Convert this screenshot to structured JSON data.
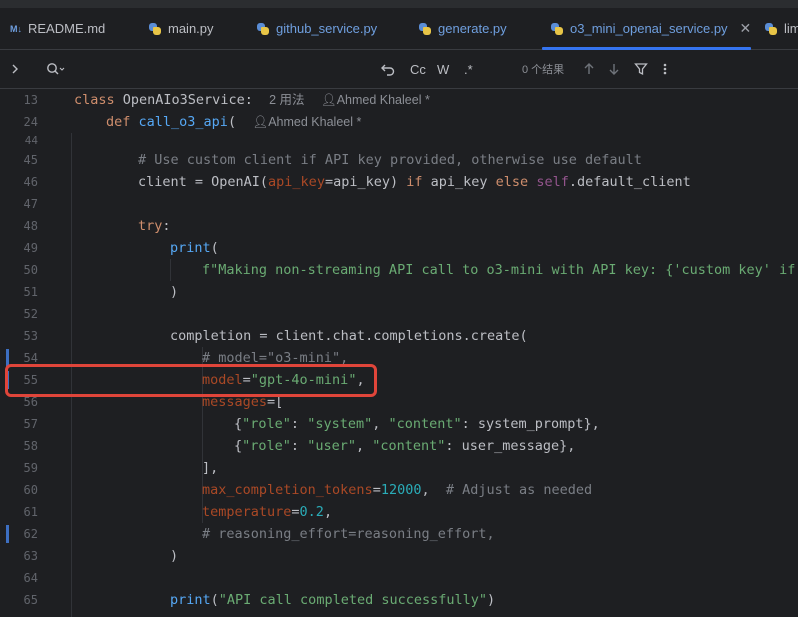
{
  "tabs": [
    {
      "label": "README.md",
      "icon": "markdown-icon",
      "active": false
    },
    {
      "label": "main.py",
      "icon": "python-icon",
      "active": false
    },
    {
      "label": "github_service.py",
      "icon": "python-icon",
      "active": false,
      "modified": true
    },
    {
      "label": "generate.py",
      "icon": "python-icon",
      "active": false,
      "modified": true
    },
    {
      "label": "o3_mini_openai_service.py",
      "icon": "python-icon",
      "active": true,
      "modified": true
    },
    {
      "label": "lim",
      "icon": "python-icon",
      "active": false
    }
  ],
  "md_badge": "M↓",
  "findbar": {
    "match_case": "Cc",
    "words": "W",
    "regex": ".*",
    "results": "0 个结果"
  },
  "sticky": {
    "class_line": {
      "num": "13",
      "keyword": "class",
      "name": "OpenAIo3Service",
      "colon": ":",
      "usages": "2 用法",
      "author": "Ahmed Khaleel *"
    },
    "def_line": {
      "num": "24",
      "keyword": "def",
      "name": "call_o3_api",
      "paren": "(",
      "author": "Ahmed Khaleel *"
    }
  },
  "lines": {
    "l44": "44",
    "l45": "45",
    "c45": "# Use custom client if API key provided, otherwise use default",
    "l46": "46",
    "c46_a": "client = OpenAI(",
    "c46_b": "api_key",
    "c46_c": "=api_key) ",
    "c46_d": "if",
    "c46_e": " api_key ",
    "c46_f": "else",
    "c46_g": " ",
    "c46_h": "self",
    "c46_i": ".default_client",
    "l47": "47",
    "l48": "48",
    "c48": "try",
    "l49": "49",
    "c49": "print",
    "l50": "50",
    "c50": "f\"Making non-streaming API call to o3-mini with API key: {'custom key' if a",
    "l51": "51",
    "l52": "52",
    "l53": "53",
    "c53": "completion = client.chat.completions.create(",
    "l54": "54",
    "c54": "# model=\"o3-mini\",",
    "l55": "55",
    "c55_a": "model",
    "c55_b": "=",
    "c55_c": "\"gpt-4o-mini\"",
    "c55_d": ",",
    "l56": "56",
    "c56": "messages",
    "l57": "57",
    "c57_a": "{",
    "c57_b": "\"role\"",
    "c57_c": ": ",
    "c57_d": "\"system\"",
    "c57_e": ", ",
    "c57_f": "\"content\"",
    "c57_g": ": system_prompt},",
    "l58": "58",
    "c58_b": "\"role\"",
    "c58_d": "\"user\"",
    "c58_f": "\"content\"",
    "c58_g": ": user_message},",
    "l59": "59",
    "c59": "],",
    "l60": "60",
    "c60_a": "max_completion_tokens",
    "c60_b": "12000",
    "c60_c": "  # Adjust as needed",
    "l61": "61",
    "c61_a": "temperature",
    "c61_b": "0.2",
    "l62": "62",
    "c62": "# reasoning_effort=reasoning_effort,",
    "l63": "63",
    "c63": ")",
    "l64": "64",
    "l65": "65",
    "c65_a": "print",
    "c65_b": "\"API call completed successfully\""
  }
}
